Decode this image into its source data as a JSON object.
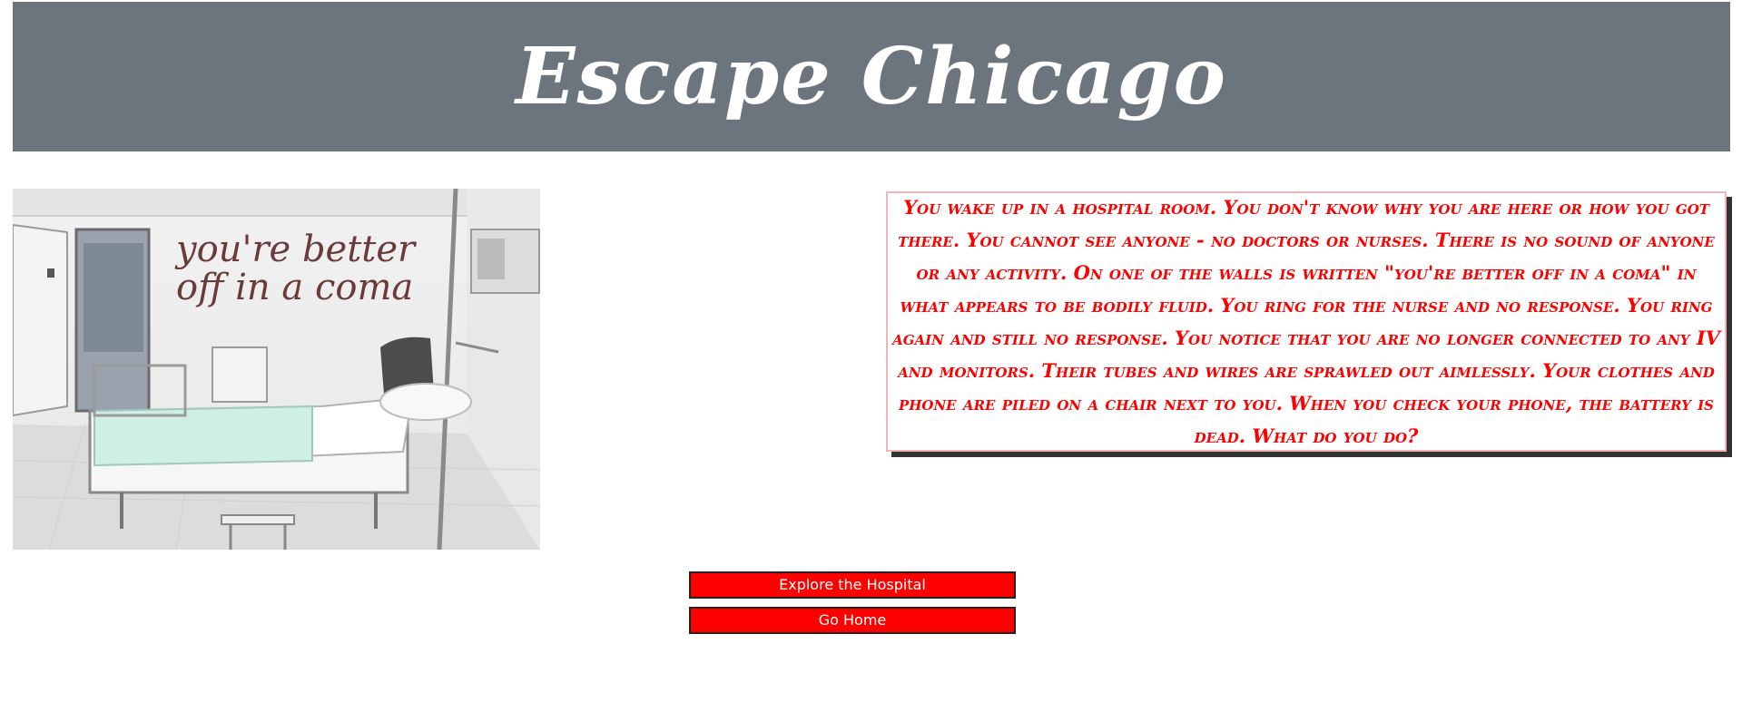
{
  "header": {
    "title": "Escape Chicago"
  },
  "scene": {
    "image_alt": "Hospital room with bed and writing on wall",
    "wall_text_line1": "you're better",
    "wall_text_line2": "off in a coma"
  },
  "story": {
    "text": "You wake up in a hospital room. You don't know why you are here or how you got there. You cannot see anyone - no doctors or nurses. There is no sound of anyone or any activity. On one of the walls is written \"you're better off in a coma\" in what appears to be bodily fluid. You ring for the nurse and no response. You ring again and still no response. You notice that you are no longer connected to any IV and monitors. Their tubes and wires are sprawled out aimlessly. Your clothes and phone are piled on a chair next to you. When you check your phone, the battery is dead. What do you do?"
  },
  "choices": [
    {
      "label": "Explore the Hospital"
    },
    {
      "label": "Go Home"
    }
  ],
  "colors": {
    "header_bg": "#6c757d",
    "accent": "#ff0000",
    "box_border": "#f2b6b6",
    "shadow": "#333333"
  }
}
